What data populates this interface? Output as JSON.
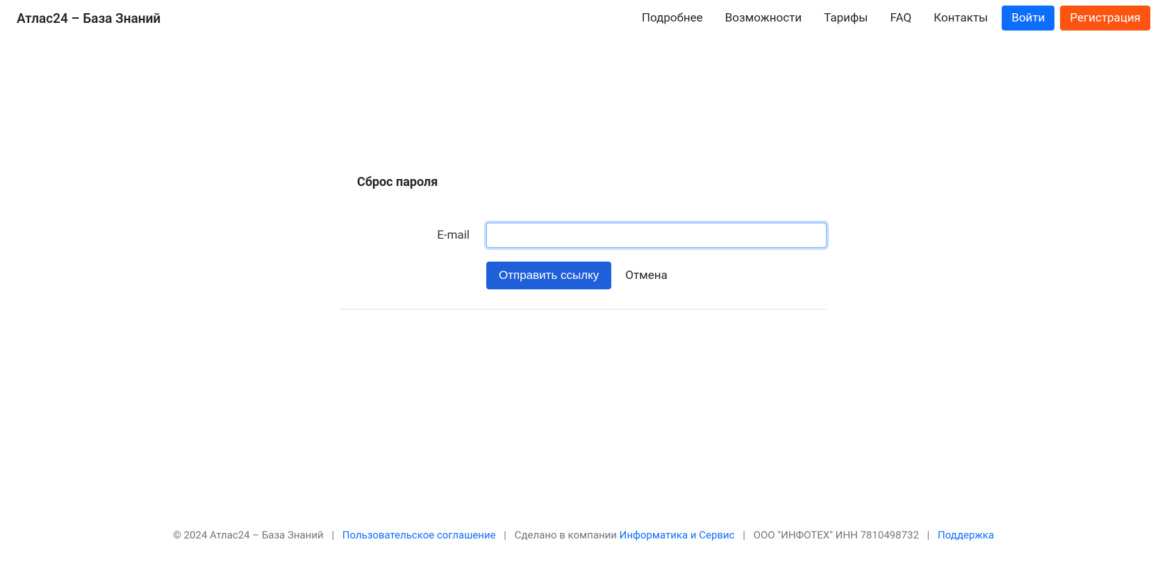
{
  "header": {
    "brand": "Атлас24 – База Знаний",
    "nav": {
      "more": "Подробнее",
      "features": "Возможности",
      "pricing": "Тарифы",
      "faq": "FAQ",
      "contacts": "Контакты"
    },
    "login": "Войти",
    "register": "Регистрация"
  },
  "form": {
    "title": "Сброс пароля",
    "email_label": "E-mail",
    "email_value": "",
    "submit": "Отправить ссылку",
    "cancel": "Отмена"
  },
  "footer": {
    "copyright": "© 2024 Атлас24 – База Знаний",
    "agreement": "Пользовательское соглашение",
    "made_in": "Сделано в компании ",
    "company_link": "Информатика и Сервис",
    "company_info": "ООО \"ИНФОТЕХ\" ИНН 7810498732",
    "support": "Поддержка",
    "sep": "|"
  }
}
